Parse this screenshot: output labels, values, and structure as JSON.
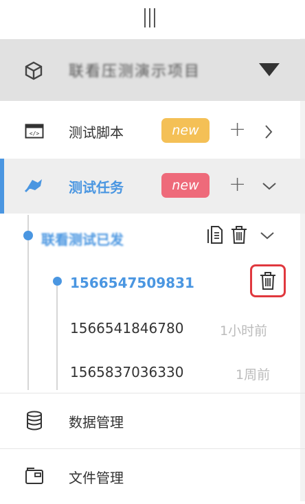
{
  "project": {
    "name": "联看压测演示项目"
  },
  "nav": {
    "scripts": {
      "label": "测试脚本",
      "badge": "new"
    },
    "tasks": {
      "label": "测试任务",
      "badge": "new"
    },
    "data": {
      "label": "数据管理"
    },
    "files": {
      "label": "文件管理"
    }
  },
  "task_group": {
    "name": "联看测试已发"
  },
  "runs": [
    {
      "id": "1566547509831",
      "time": ""
    },
    {
      "id": "1566541846780",
      "time": "1小时前"
    },
    {
      "id": "1565837036330",
      "time": "1周前"
    }
  ],
  "colors": {
    "accent": "#4a96e1",
    "badge_orange": "#f4c056",
    "badge_red": "#ee6a7a",
    "highlight": "#e0383e"
  }
}
